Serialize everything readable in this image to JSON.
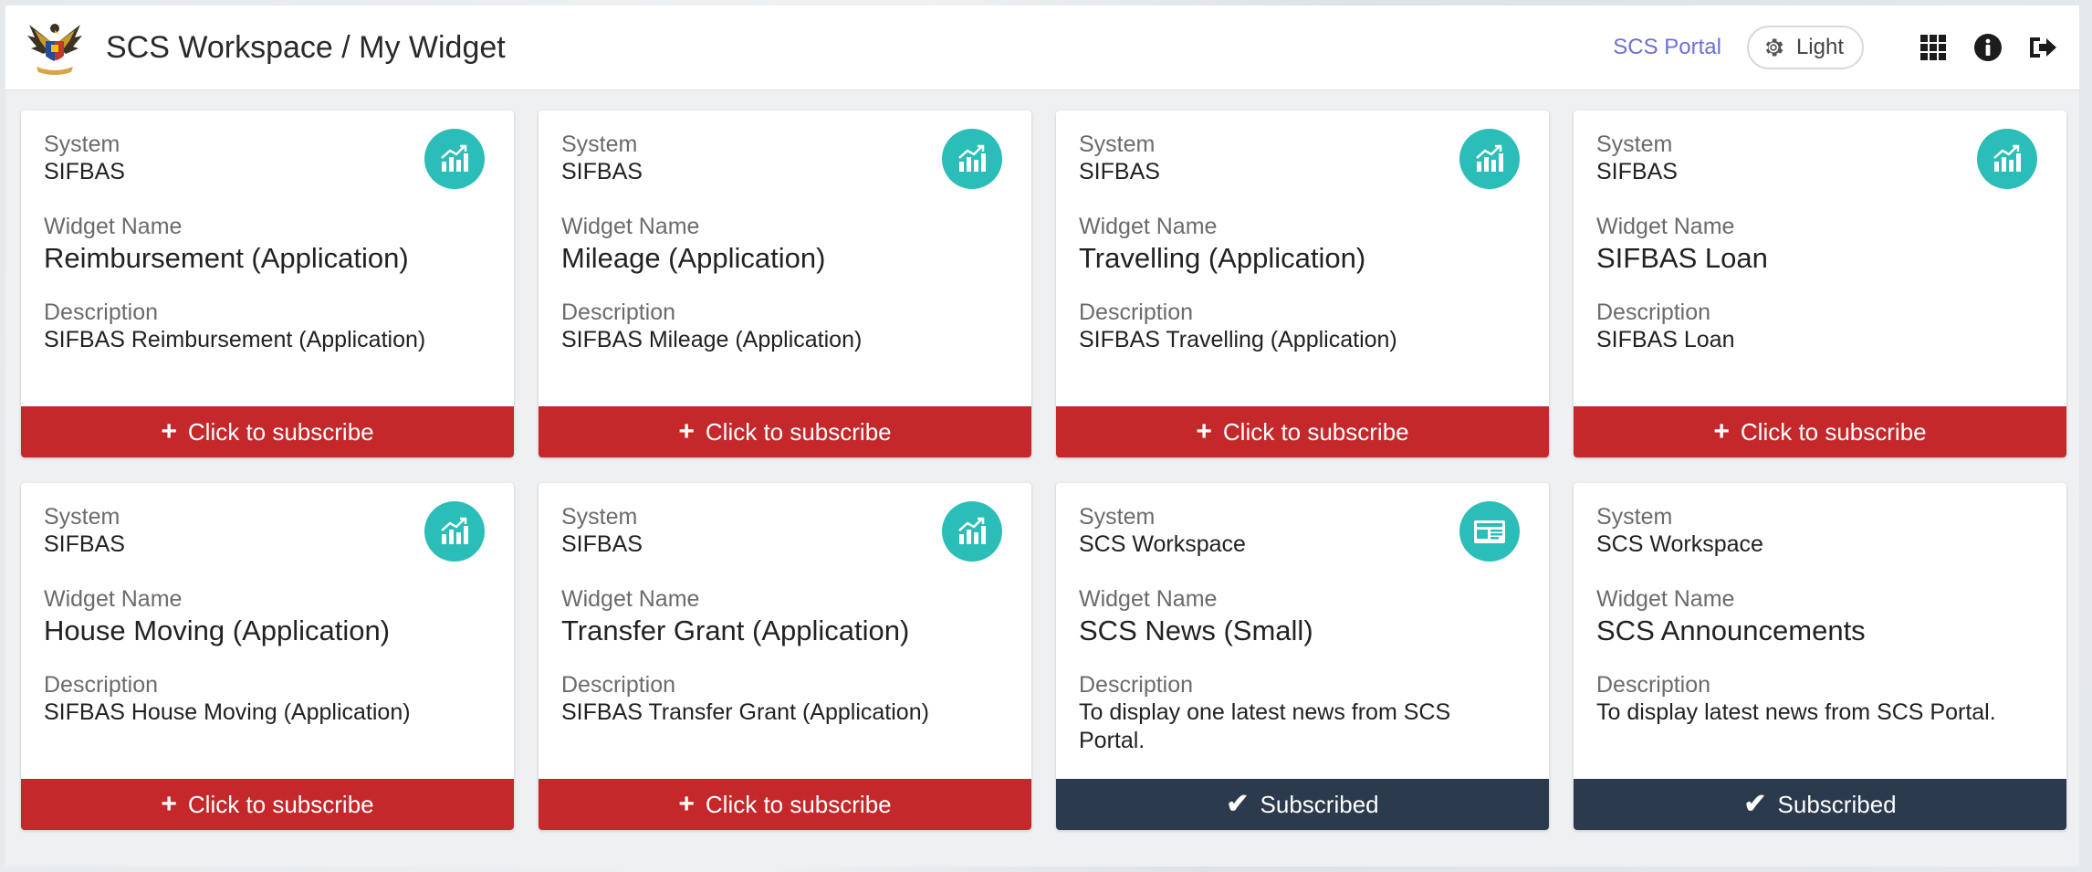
{
  "header": {
    "title": "SCS Workspace / My Widget",
    "portal_link": "SCS Portal",
    "theme_label": "Light"
  },
  "labels": {
    "system": "System",
    "widget_name": "Widget Name",
    "description": "Description"
  },
  "colors": {
    "subscribe_btn": "#c4282a",
    "subscribed_btn": "#2b3a4d",
    "badge": "#2bbdb8",
    "portal_link": "#6d6fd6"
  },
  "cards": [
    {
      "system": "SIFBAS",
      "widget_name": "Reimbursement (Application)",
      "description": "SIFBAS Reimbursement (Application)",
      "icon": "chart-growth-icon",
      "button_label": "Click to subscribe",
      "subscribed": false
    },
    {
      "system": "SIFBAS",
      "widget_name": "Mileage (Application)",
      "description": "SIFBAS Mileage (Application)",
      "icon": "chart-growth-icon",
      "button_label": "Click to subscribe",
      "subscribed": false
    },
    {
      "system": "SIFBAS",
      "widget_name": "Travelling (Application)",
      "description": "SIFBAS Travelling (Application)",
      "icon": "chart-growth-icon",
      "button_label": "Click to subscribe",
      "subscribed": false
    },
    {
      "system": "SIFBAS",
      "widget_name": "SIFBAS Loan",
      "description": "SIFBAS Loan",
      "icon": "chart-growth-icon",
      "button_label": "Click to subscribe",
      "subscribed": false
    },
    {
      "system": "SIFBAS",
      "widget_name": "House Moving (Application)",
      "description": "SIFBAS House Moving (Application)",
      "icon": "chart-growth-icon",
      "button_label": "Click to subscribe",
      "subscribed": false
    },
    {
      "system": "SIFBAS",
      "widget_name": "Transfer Grant (Application)",
      "description": "SIFBAS Transfer Grant (Application)",
      "icon": "chart-growth-icon",
      "button_label": "Click to subscribe",
      "subscribed": false
    },
    {
      "system": "SCS Workspace",
      "widget_name": "SCS News (Small)",
      "description": "To display one latest news from SCS Portal.",
      "icon": "newspaper-icon",
      "button_label": "Subscribed",
      "subscribed": true
    },
    {
      "system": "SCS Workspace",
      "widget_name": "SCS Announcements",
      "description": "To display latest news from SCS Portal.",
      "icon": "",
      "button_label": "Subscribed",
      "subscribed": true
    }
  ]
}
